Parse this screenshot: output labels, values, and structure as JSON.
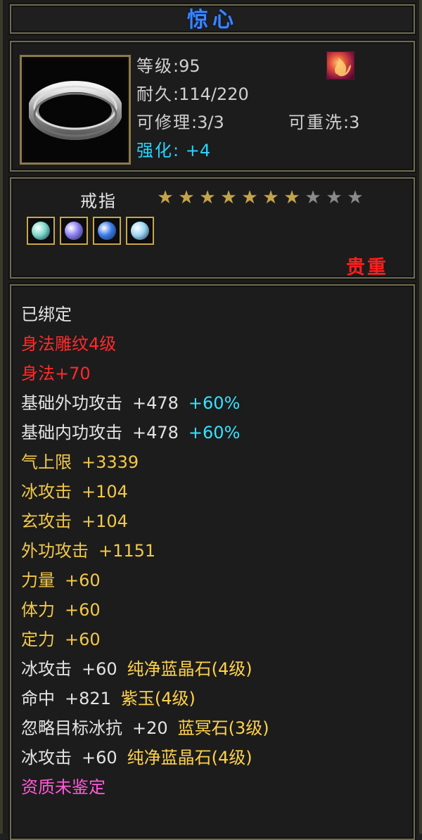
{
  "item": {
    "name": "惊心",
    "type": "戒指",
    "rarity": "贵重",
    "level_label": "等级",
    "level_value": "95",
    "durability_label": "耐久",
    "durability_value": "114/220",
    "repair_label": "可修理",
    "repair_value": "3/3",
    "rewash_label": "可重洗",
    "rewash_value": "3",
    "enhance_label": "强化:",
    "enhance_value": "+4",
    "stars_total": 10,
    "stars_filled": 7,
    "icon_name": "silver-ring-icon",
    "badge_icon": "flame-badge-icon"
  },
  "gems": [
    {
      "icon": "green-gem-icon",
      "color": "#7ad8c8"
    },
    {
      "icon": "purple-gem-icon",
      "color": "#8c7cf0"
    },
    {
      "icon": "blue-gem-icon",
      "color": "#3a7ae8"
    },
    {
      "icon": "cyan-gem-icon",
      "color": "#9ad6f0"
    }
  ],
  "attributes": [
    {
      "segments": [
        {
          "text": "已绑定",
          "color": "white"
        }
      ]
    },
    {
      "segments": [
        {
          "text": "身法雕纹4级",
          "color": "red"
        }
      ]
    },
    {
      "segments": [
        {
          "text": "身法+70",
          "color": "red"
        }
      ]
    },
    {
      "segments": [
        {
          "text": "基础外功攻击",
          "color": "white"
        },
        {
          "text": "+478",
          "color": "white"
        },
        {
          "text": "+60%",
          "color": "cyan"
        }
      ]
    },
    {
      "segments": [
        {
          "text": "基础内功攻击",
          "color": "white"
        },
        {
          "text": "+478",
          "color": "white"
        },
        {
          "text": "+60%",
          "color": "cyan"
        }
      ]
    },
    {
      "segments": [
        {
          "text": "气上限",
          "color": "yellow"
        },
        {
          "text": "+3339",
          "color": "yellow"
        }
      ]
    },
    {
      "segments": [
        {
          "text": "冰攻击",
          "color": "yellow"
        },
        {
          "text": "+104",
          "color": "yellow"
        }
      ]
    },
    {
      "segments": [
        {
          "text": "玄攻击",
          "color": "yellow"
        },
        {
          "text": "+104",
          "color": "yellow"
        }
      ]
    },
    {
      "segments": [
        {
          "text": "外功攻击",
          "color": "yellow"
        },
        {
          "text": "+1151",
          "color": "yellow"
        }
      ]
    },
    {
      "segments": [
        {
          "text": "力量",
          "color": "yellow"
        },
        {
          "text": "+60",
          "color": "yellow"
        }
      ]
    },
    {
      "segments": [
        {
          "text": "体力",
          "color": "yellow"
        },
        {
          "text": "+60",
          "color": "yellow"
        }
      ]
    },
    {
      "segments": [
        {
          "text": "定力",
          "color": "yellow"
        },
        {
          "text": "+60",
          "color": "yellow"
        }
      ]
    },
    {
      "segments": [
        {
          "text": "冰攻击",
          "color": "white"
        },
        {
          "text": "+60",
          "color": "white"
        },
        {
          "text": "纯净蓝晶石(4级)",
          "color": "gold"
        }
      ]
    },
    {
      "segments": [
        {
          "text": "命中",
          "color": "white"
        },
        {
          "text": "+821",
          "color": "white"
        },
        {
          "text": "紫玉(4级)",
          "color": "gold"
        }
      ]
    },
    {
      "segments": [
        {
          "text": "忽略目标冰抗",
          "color": "white"
        },
        {
          "text": "+20",
          "color": "white"
        },
        {
          "text": "蓝冥石(3级)",
          "color": "gold"
        }
      ]
    },
    {
      "segments": [
        {
          "text": "冰攻击",
          "color": "white"
        },
        {
          "text": "+60",
          "color": "white"
        },
        {
          "text": "纯净蓝晶石(4级)",
          "color": "gold"
        }
      ]
    },
    {
      "segments": [
        {
          "text": "资质未鉴定",
          "color": "pink"
        }
      ]
    }
  ]
}
